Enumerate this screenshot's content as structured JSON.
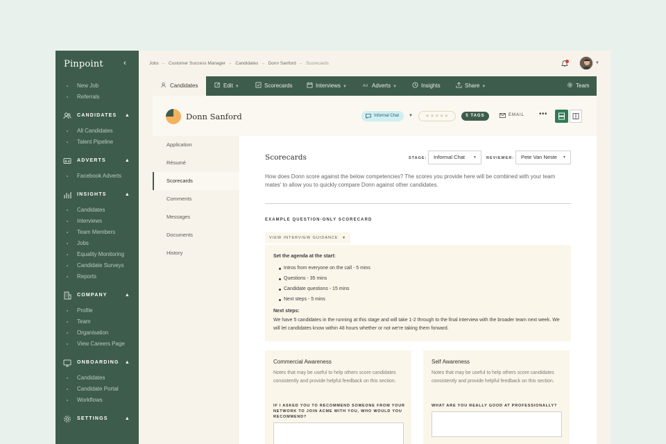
{
  "app": {
    "brand": "Pinpoint"
  },
  "sidebar": {
    "top_items": [
      "New Job",
      "Referrals"
    ],
    "sections": [
      {
        "title": "CANDIDATES",
        "icon": "users-icon",
        "items": [
          "All Candidates",
          "Talent Pipeline"
        ]
      },
      {
        "title": "ADVERTS",
        "icon": "advert-icon",
        "items": [
          "Facebook Adverts"
        ]
      },
      {
        "title": "INSIGHTS",
        "icon": "bar-chart-icon",
        "items": [
          "Candidates",
          "Interviews",
          "Team Members",
          "Jobs",
          "Equality Monitoring",
          "Candidate Surveys",
          "Reports"
        ]
      },
      {
        "title": "COMPANY",
        "icon": "building-icon",
        "items": [
          "Profile",
          "Team",
          "Organisation",
          "View Careers Page"
        ]
      },
      {
        "title": "ONBOARDING",
        "icon": "monitor-icon",
        "items": [
          "Candidates",
          "Candidate Portal",
          "Workflows"
        ]
      },
      {
        "title": "SETTINGS",
        "icon": "gear-icon",
        "items": []
      }
    ]
  },
  "breadcrumb": [
    "Jobs",
    "Customer Success Manager",
    "Candidates",
    "Donn Sanford",
    "Scorecards"
  ],
  "tabs": {
    "candidates": "Candidates",
    "edit": "Edit",
    "scorecards": "Scorecards",
    "interviews": "Interviews",
    "adverts": "Adverts",
    "insights": "Insights",
    "share": "Share",
    "team": "Team"
  },
  "candidate": {
    "name": "Donn Sanford",
    "stage": "Informal Chat",
    "stars": "★★★★★",
    "rating": 0,
    "tags": "5 TAGS",
    "email": "EMAIL",
    "more": "•••"
  },
  "subnav": [
    "Application",
    "Résumé",
    "Scorecards",
    "Comments",
    "Messages",
    "Documents",
    "History"
  ],
  "scorecards": {
    "title": "Scorecards",
    "stage_label": "STAGE:",
    "stage_value": "Informal Chat",
    "reviewer_label": "REVIEWER:",
    "reviewer_value": "Pete Van Neste",
    "intro": "How does Donn score against the below competencies? The scores you provide here will be combined with your team mates' to allow you to quickly compare Donn against other candidates.",
    "scorecard_title": "EXAMPLE QUESTION-ONLY SCORECARD",
    "guidance_button": "VIEW INTERVIEW GUIDANCE",
    "guidance": {
      "agenda_heading": "Set the agenda at the start:",
      "agenda_items": [
        "Intros from everyone on the call - 5 mins",
        "Questions - 35 mins",
        "Candidate questions - 15 mins",
        "Next steps - 5 mins"
      ],
      "next_heading": "Next steps:",
      "next_text": "We have 5 candidates in the running at this stage and will take 1-2 through to the final interview with the broader team next week. We will let candidates know within 48 hours whether or not we're taking them forward."
    },
    "cards": [
      {
        "title": "Commercial Awareness",
        "notes": "Notes that may be useful to help others score candidates consistently and provide helpful feedback on this section.",
        "question": "If I asked you to recommend someone from your network to join Acme with you, who would you recommend?"
      },
      {
        "title": "Self Awareness",
        "notes": "Notes that may be useful to help others score candidates consistently and provide helpful feedback on this section.",
        "question": "What are you really good at professionally?"
      }
    ]
  },
  "colors": {
    "brand_green": "#3e5c4b",
    "accent_green": "#2f7a57",
    "page_bg": "#e9f1ec",
    "stage_pill": "#cfeff2",
    "notification": "#d93a3a"
  }
}
